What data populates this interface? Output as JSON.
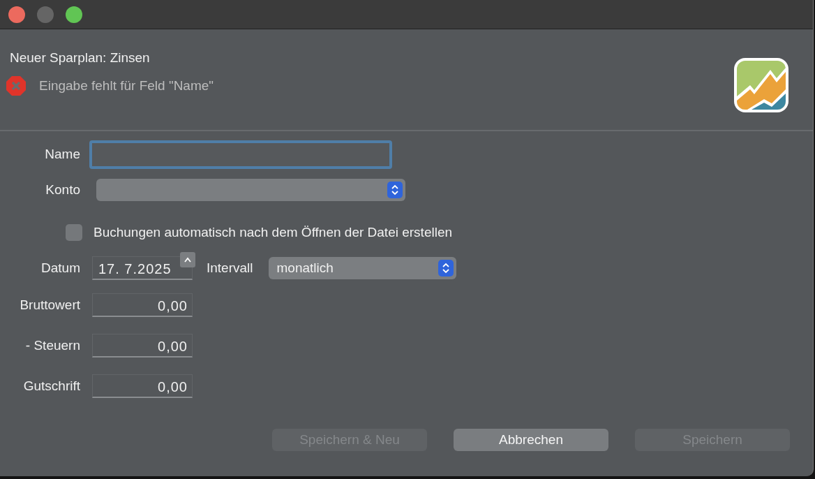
{
  "window": {
    "title": "Neuer Sparplan: Zinsen"
  },
  "error": {
    "message": "Eingabe fehlt für Feld \"Name\""
  },
  "name_field": {
    "label": "Name",
    "focused": true
  },
  "konto_field": {
    "label": "Konto"
  },
  "auto_checkbox": {
    "label": "Buchungen automatisch nach dem Öffnen der Datei erstellen",
    "checked": false
  },
  "datum_field": {
    "label": "Datum",
    "value": "17. 7.2025"
  },
  "intervall_field": {
    "label": "Intervall",
    "value": "monatlich"
  },
  "amounts": [
    {
      "label": "Bruttowert",
      "value": "0,00"
    },
    {
      "label": "- Steuern",
      "value": "0,00"
    },
    {
      "label": "Gutschrift",
      "value": "0,00"
    }
  ],
  "buttons": [
    {
      "label": "Speichern & Neu",
      "disabled": true
    },
    {
      "label": "Abbrechen",
      "disabled": false
    },
    {
      "label": "Speichern",
      "disabled": true
    }
  ]
}
